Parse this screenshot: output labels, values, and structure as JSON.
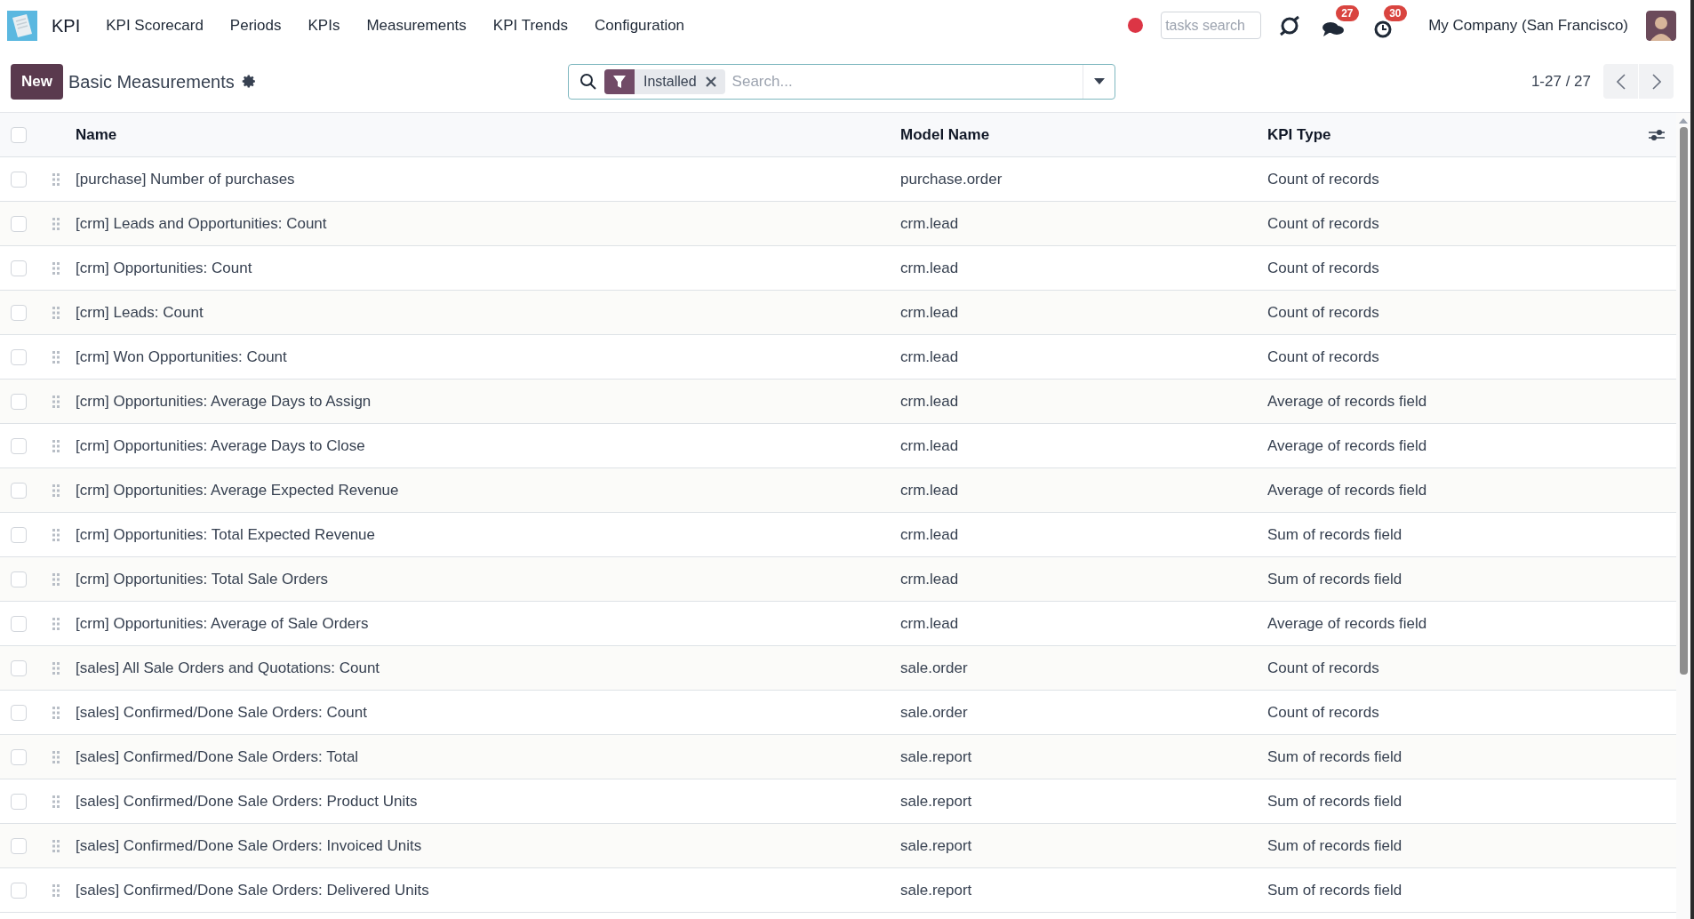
{
  "navbar": {
    "app_name": "KPI",
    "menu": [
      "KPI Scorecard",
      "Periods",
      "KPIs",
      "Measurements",
      "KPI Trends",
      "Configuration"
    ],
    "tasks_search": {
      "placeholder": "tasks search"
    },
    "messages_count": "27",
    "activities_count": "30",
    "company": "My Company (San Francisco)"
  },
  "control_panel": {
    "new_button": "New",
    "title": "Basic Measurements",
    "search": {
      "facets": [
        {
          "label": "Installed"
        }
      ],
      "placeholder": "Search..."
    },
    "pager": "1-27 / 27"
  },
  "table": {
    "select_all_checked": false,
    "columns": [
      "Name",
      "Model Name",
      "KPI Type"
    ],
    "rows": [
      {
        "name": "[purchase] Number of purchases",
        "model": "purchase.order",
        "kpi_type": "Count of records",
        "checked": false
      },
      {
        "name": "[crm] Leads and Opportunities: Count",
        "model": "crm.lead",
        "kpi_type": "Count of records",
        "checked": false
      },
      {
        "name": "[crm] Opportunities: Count",
        "model": "crm.lead",
        "kpi_type": "Count of records",
        "checked": false
      },
      {
        "name": "[crm] Leads: Count",
        "model": "crm.lead",
        "kpi_type": "Count of records",
        "checked": false
      },
      {
        "name": "[crm] Won Opportunities: Count",
        "model": "crm.lead",
        "kpi_type": "Count of records",
        "checked": false
      },
      {
        "name": "[crm] Opportunities: Average Days to Assign",
        "model": "crm.lead",
        "kpi_type": "Average of records field",
        "checked": false
      },
      {
        "name": "[crm] Opportunities: Average Days to Close",
        "model": "crm.lead",
        "kpi_type": "Average of records field",
        "checked": false
      },
      {
        "name": "[crm] Opportunities: Average Expected Revenue",
        "model": "crm.lead",
        "kpi_type": "Average of records field",
        "checked": false
      },
      {
        "name": "[crm] Opportunities: Total Expected Revenue",
        "model": "crm.lead",
        "kpi_type": "Sum of records field",
        "checked": false
      },
      {
        "name": "[crm] Opportunities: Total Sale Orders",
        "model": "crm.lead",
        "kpi_type": "Sum of records field",
        "checked": false
      },
      {
        "name": "[crm] Opportunities: Average of Sale Orders",
        "model": "crm.lead",
        "kpi_type": "Average of records field",
        "checked": false
      },
      {
        "name": "[sales] All Sale Orders and Quotations: Count",
        "model": "sale.order",
        "kpi_type": "Count of records",
        "checked": false
      },
      {
        "name": "[sales] Confirmed/Done Sale Orders: Count",
        "model": "sale.order",
        "kpi_type": "Count of records",
        "checked": false
      },
      {
        "name": "[sales] Confirmed/Done Sale Orders: Total",
        "model": "sale.report",
        "kpi_type": "Sum of records field",
        "checked": false
      },
      {
        "name": "[sales] Confirmed/Done Sale Orders: Product Units",
        "model": "sale.report",
        "kpi_type": "Sum of records field",
        "checked": false
      },
      {
        "name": "[sales] Confirmed/Done Sale Orders: Invoiced Units",
        "model": "sale.report",
        "kpi_type": "Sum of records field",
        "checked": false
      },
      {
        "name": "[sales] Confirmed/Done Sale Orders: Delivered Units",
        "model": "sale.report",
        "kpi_type": "Sum of records field",
        "checked": false
      }
    ]
  }
}
